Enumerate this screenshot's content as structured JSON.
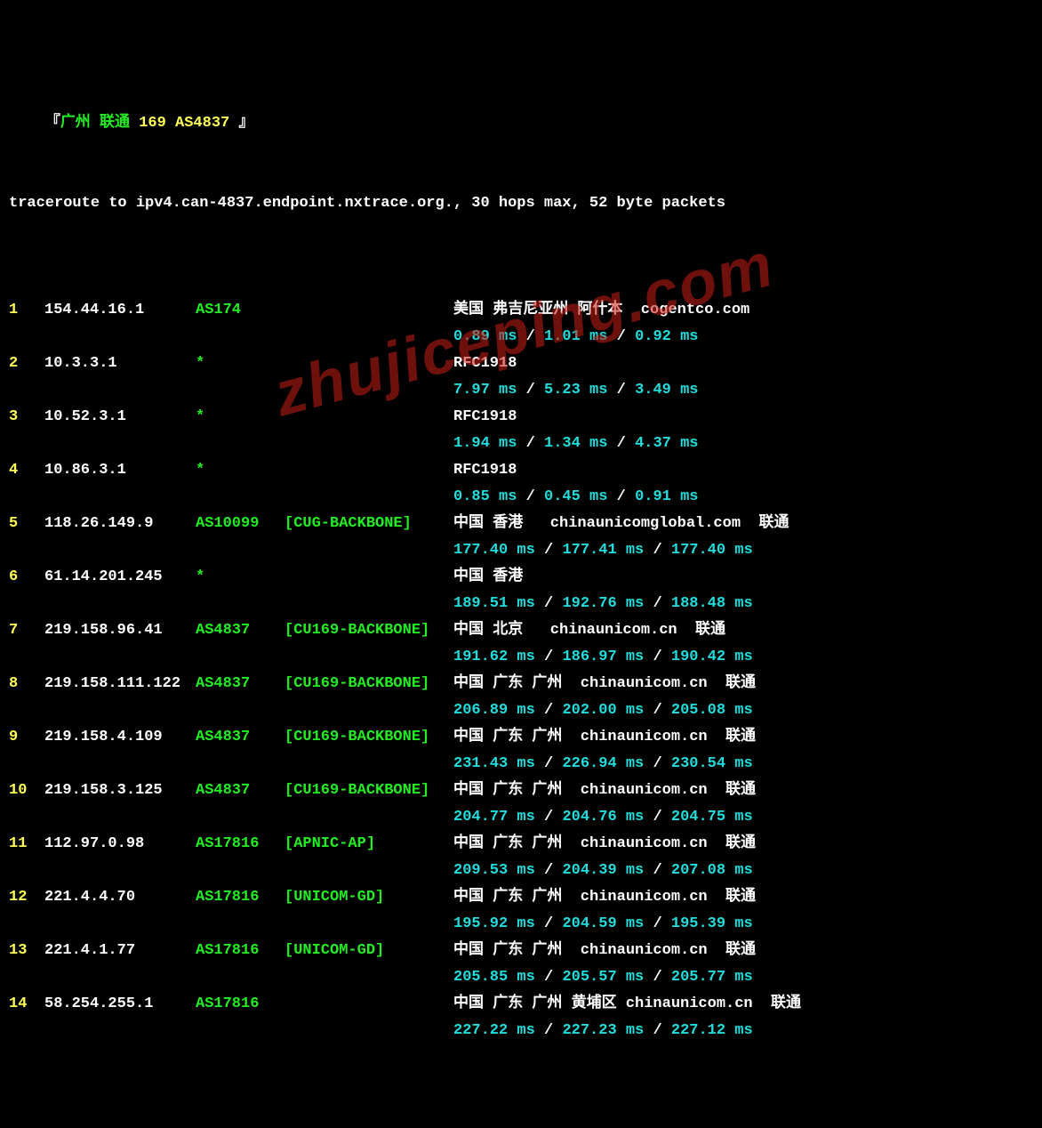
{
  "title": {
    "open": "『",
    "part1": "广州 联通 ",
    "part2": "169 AS4837 ",
    "close": "』"
  },
  "intro": "traceroute to ipv4.can-4837.endpoint.nxtrace.org., 30 hops max, 52 byte packets",
  "hops": [
    {
      "n": "1",
      "ip": "154.44.16.1",
      "asn": "AS174",
      "tag": "",
      "loc": "美国 弗吉尼亚州 阿什本  cogentco.com",
      "rtt": [
        "0.89 ms",
        "1.01 ms",
        "0.92 ms"
      ]
    },
    {
      "n": "2",
      "ip": "10.3.3.1",
      "asn": "*",
      "tag": "",
      "loc": "RFC1918",
      "rtt": [
        "7.97 ms",
        "5.23 ms",
        "3.49 ms"
      ]
    },
    {
      "n": "3",
      "ip": "10.52.3.1",
      "asn": "*",
      "tag": "",
      "loc": "RFC1918",
      "rtt": [
        "1.94 ms",
        "1.34 ms",
        "4.37 ms"
      ]
    },
    {
      "n": "4",
      "ip": "10.86.3.1",
      "asn": "*",
      "tag": "",
      "loc": "RFC1918",
      "rtt": [
        "0.85 ms",
        "0.45 ms",
        "0.91 ms"
      ]
    },
    {
      "n": "5",
      "ip": "118.26.149.9",
      "asn": "AS10099",
      "tag": "[CUG-BACKBONE]",
      "loc": "中国 香港   chinaunicomglobal.com  联通",
      "rtt": [
        "177.40 ms",
        "177.41 ms",
        "177.40 ms"
      ]
    },
    {
      "n": "6",
      "ip": "61.14.201.245",
      "asn": "*",
      "tag": "",
      "loc": "中国 香港",
      "rtt": [
        "189.51 ms",
        "192.76 ms",
        "188.48 ms"
      ]
    },
    {
      "n": "7",
      "ip": "219.158.96.41",
      "asn": "AS4837",
      "tag": "[CU169-BACKBONE]",
      "loc": "中国 北京   chinaunicom.cn  联通",
      "rtt": [
        "191.62 ms",
        "186.97 ms",
        "190.42 ms"
      ]
    },
    {
      "n": "8",
      "ip": "219.158.111.122",
      "asn": "AS4837",
      "tag": "[CU169-BACKBONE]",
      "loc": "中国 广东 广州  chinaunicom.cn  联通",
      "rtt": [
        "206.89 ms",
        "202.00 ms",
        "205.08 ms"
      ]
    },
    {
      "n": "9",
      "ip": "219.158.4.109",
      "asn": "AS4837",
      "tag": "[CU169-BACKBONE]",
      "loc": "中国 广东 广州  chinaunicom.cn  联通",
      "rtt": [
        "231.43 ms",
        "226.94 ms",
        "230.54 ms"
      ]
    },
    {
      "n": "10",
      "ip": "219.158.3.125",
      "asn": "AS4837",
      "tag": "[CU169-BACKBONE]",
      "loc": "中国 广东 广州  chinaunicom.cn  联通",
      "rtt": [
        "204.77 ms",
        "204.76 ms",
        "204.75 ms"
      ]
    },
    {
      "n": "11",
      "ip": "112.97.0.98",
      "asn": "AS17816",
      "tag": "[APNIC-AP]",
      "loc": "中国 广东 广州  chinaunicom.cn  联通",
      "rtt": [
        "209.53 ms",
        "204.39 ms",
        "207.08 ms"
      ]
    },
    {
      "n": "12",
      "ip": "221.4.4.70",
      "asn": "AS17816",
      "tag": "[UNICOM-GD]",
      "loc": "中国 广东 广州  chinaunicom.cn  联通",
      "rtt": [
        "195.92 ms",
        "204.59 ms",
        "195.39 ms"
      ]
    },
    {
      "n": "13",
      "ip": "221.4.1.77",
      "asn": "AS17816",
      "tag": "[UNICOM-GD]",
      "loc": "中国 广东 广州  chinaunicom.cn  联通",
      "rtt": [
        "205.85 ms",
        "205.57 ms",
        "205.77 ms"
      ]
    },
    {
      "n": "14",
      "ip": "58.254.255.1",
      "asn": "AS17816",
      "tag": "",
      "loc": "中国 广东 广州 黄埔区 chinaunicom.cn  联通",
      "rtt": [
        "227.22 ms",
        "227.23 ms",
        "227.12 ms"
      ]
    }
  ],
  "watermark": "zhujiceping.com"
}
